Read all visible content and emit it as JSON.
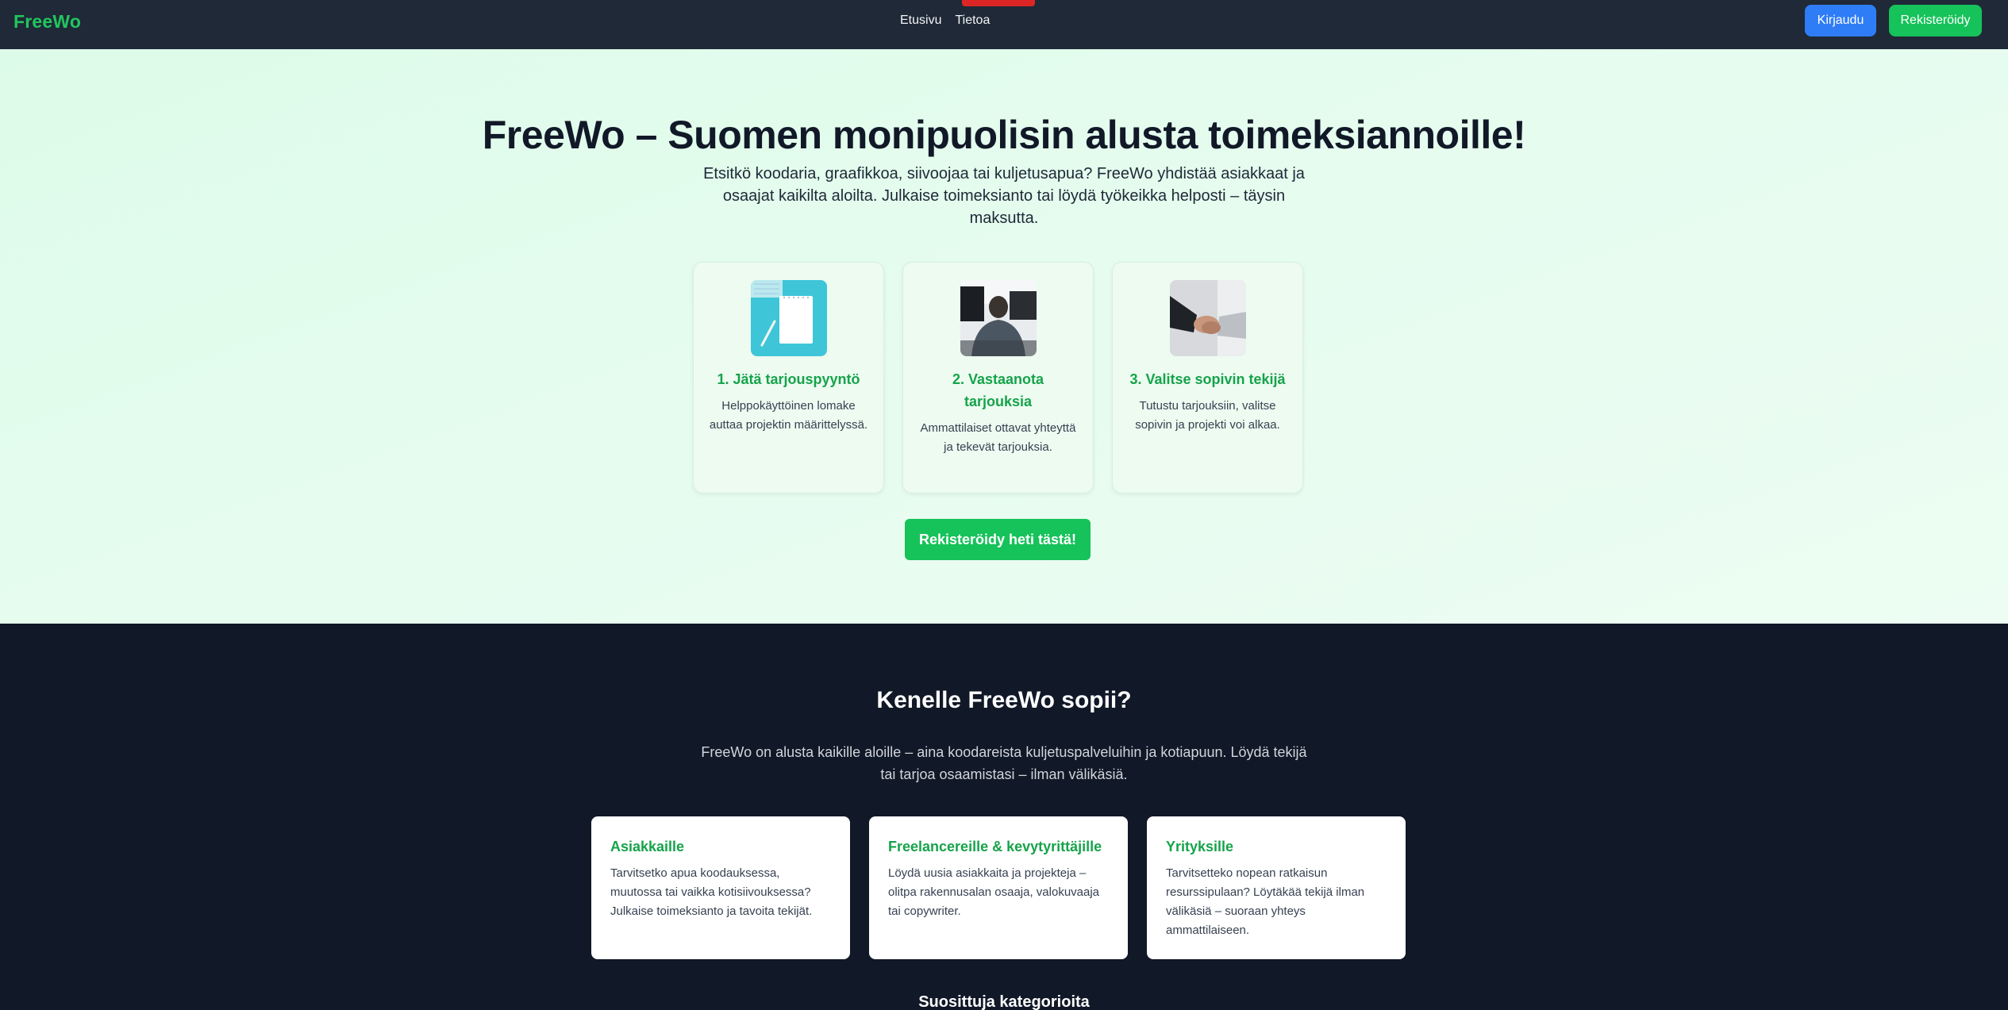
{
  "nav": {
    "logo": "FreeWo",
    "links": [
      "Etusivu",
      "Tietoa"
    ],
    "login": "Kirjaudu",
    "register": "Rekisteröidy"
  },
  "hero": {
    "title": "FreeWo – Suomen monipuolisin alusta toimeksiannoille!",
    "description": "Etsitkö koodaria, graafikkoa, siivoojaa tai kuljetusapua? FreeWo yhdistää asiakkaat ja osaajat kaikilta aloilta. Julkaise toimeksianto tai löydä työkeikka helposti – täysin maksutta.",
    "steps": [
      {
        "title": "1. Jätä tarjouspyyntö",
        "text": "Helppokäyttöinen lomake auttaa projektin määrittelyssä.",
        "image": "notepad-image"
      },
      {
        "title": "2. Vastaanota tarjouksia",
        "text": "Ammattilaiset ottavat yhteyttä ja tekevät tarjouksia.",
        "image": "person-at-computer-image"
      },
      {
        "title": "3. Valitse sopivin tekijä",
        "text": "Tutustu tarjouksiin, valitse sopivin ja projekti voi alkaa.",
        "image": "handshake-image"
      }
    ],
    "cta": "Rekisteröidy heti tästä!"
  },
  "audience": {
    "title": "Kenelle FreeWo sopii?",
    "description": "FreeWo on alusta kaikille aloille – aina koodareista kuljetuspalveluihin ja kotiapuun. Löydä tekijä tai tarjoa osaamistasi – ilman välikäsiä.",
    "cards": [
      {
        "title": "Asiakkaille",
        "text": "Tarvitsetko apua koodauksessa, muutossa tai vaikka kotisiivouksessa? Julkaise toimeksianto ja tavoita tekijät."
      },
      {
        "title": "Freelancereille & kevytyrittäjille",
        "text": "Löydä uusia asiakkaita ja projekteja – olitpa rakennusalan osaaja, valokuvaaja tai copywriter."
      },
      {
        "title": "Yrityksille",
        "text": "Tarvitsetteko nopean ratkaisun resurssipulaan? Löytäkää tekijä ilman välikäsiä – suoraan yhteys ammattilaiseen."
      }
    ],
    "categories_title": "Suosittuja kategorioita"
  },
  "colors": {
    "nav_bg": "#1f2937",
    "brand_green": "#16c25a",
    "login_blue": "#2f7df6",
    "dark_section": "#111827"
  }
}
